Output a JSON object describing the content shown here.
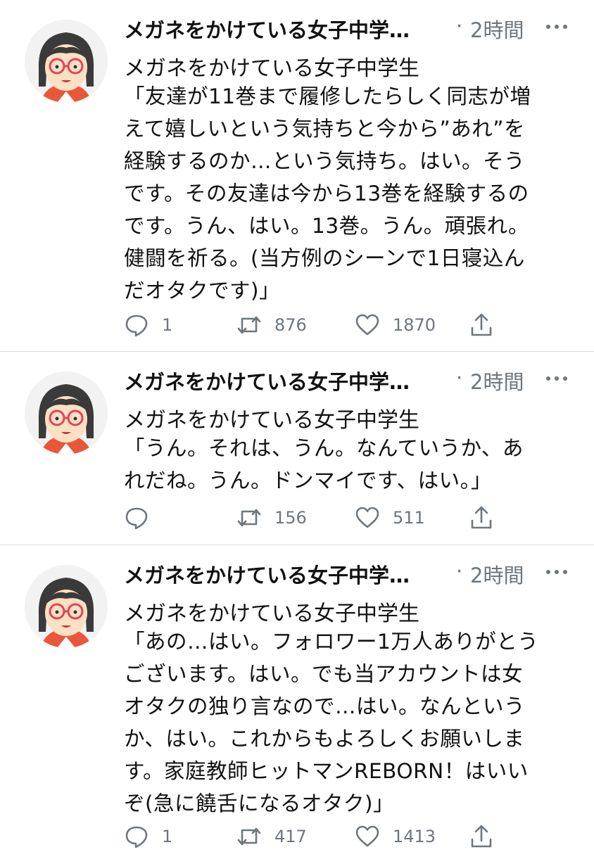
{
  "tweets": [
    {
      "header_name": "メガネをかけている女子中学…",
      "time": "2時間",
      "display_name": "メガネをかけている女子中学生",
      "text": "「友達が11巻まで履修したらしく同志が増\nえて嬉しいという気持ちと今から”あれ”を\n経験するのか…という気持ち。はい。そう\nです。その友達は今から13巻を経験するの\nです。うん、はい。13巻。うん。頑張れ。\n健闘を祈る。(当方例のシーンで1日寝込ん\nだオタクです)」",
      "reply_count": "1",
      "retweet_count": "876",
      "like_count": "1870"
    },
    {
      "header_name": "メガネをかけている女子中学…",
      "time": "2時間",
      "display_name": "メガネをかけている女子中学生",
      "text": "「うん。それは、うん。なんていうか、あ\nれだね。うん。ドンマイです、はい。」",
      "reply_count": "",
      "retweet_count": "156",
      "like_count": "511"
    },
    {
      "header_name": "メガネをかけている女子中学…",
      "time": "2時間",
      "display_name": "メガネをかけている女子中学生",
      "text": "「あの…はい。フォロワー1万人ありがとう\nございます。はい。でも当アカウントは女\nオタクの独り言なので…はい。なんという\nか、はい。これからもよろしくお願いしま\nす。家庭教師ヒットマンREBORN！はいい\nぞ(急に饒舌になるオタク)」",
      "reply_count": "1",
      "retweet_count": "417",
      "like_count": "1413"
    }
  ],
  "dot": "·",
  "icons": {
    "avatar": "girl-with-glasses-avatar",
    "more": "more-options-icon",
    "reply": "reply-bubble-icon",
    "retweet": "retweet-icon",
    "like": "heart-icon",
    "share": "share-icon"
  },
  "colors": {
    "text": "#111111",
    "muted": "#6e767d",
    "divider": "#dcdcdc"
  }
}
